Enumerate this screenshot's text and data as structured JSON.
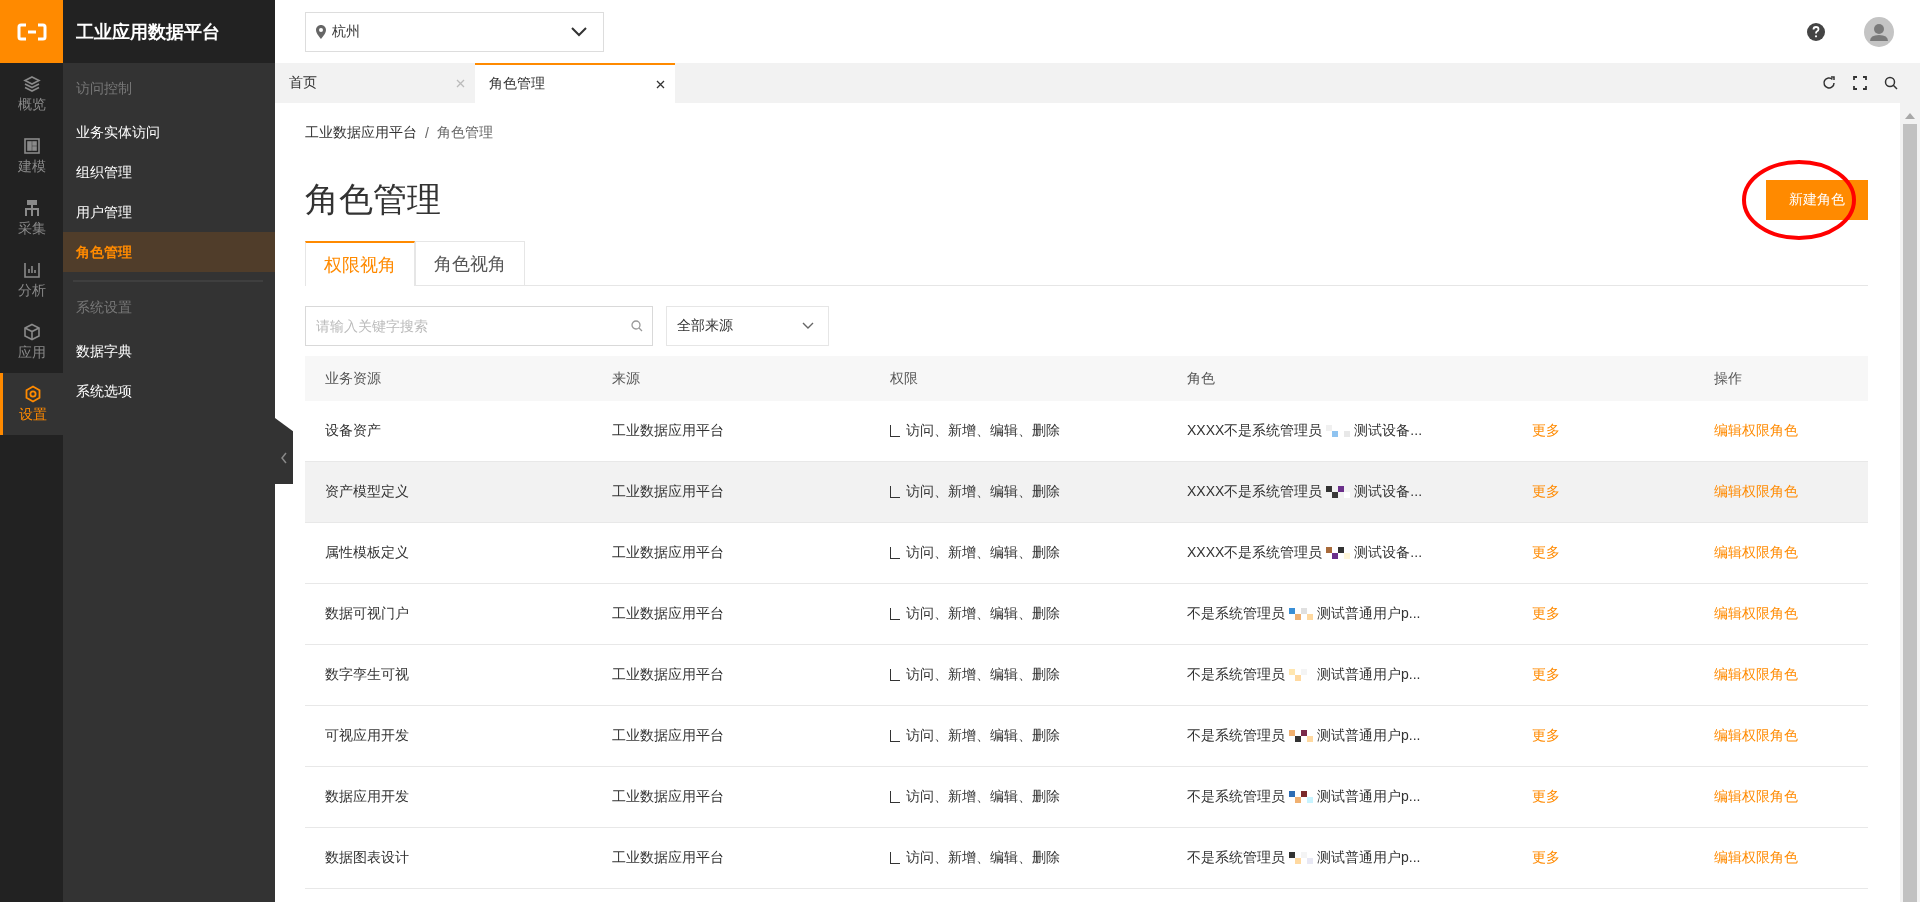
{
  "brand": {
    "title": "工业应用数据平台"
  },
  "rail": [
    {
      "label": "概览",
      "selected": false
    },
    {
      "label": "建模",
      "selected": false
    },
    {
      "label": "采集",
      "selected": false
    },
    {
      "label": "分析",
      "selected": false
    },
    {
      "label": "应用",
      "selected": false
    },
    {
      "label": "设置",
      "selected": true
    }
  ],
  "subnav_groups": [
    {
      "heading": "访问控制",
      "items": [
        {
          "label": "业务实体访问",
          "selected": false
        },
        {
          "label": "组织管理",
          "selected": false
        },
        {
          "label": "用户管理",
          "selected": false
        },
        {
          "label": "角色管理",
          "selected": true
        }
      ]
    },
    {
      "heading": "系统设置",
      "items": [
        {
          "label": "数据字典",
          "selected": false
        },
        {
          "label": "系统选项",
          "selected": false
        }
      ]
    }
  ],
  "topbar": {
    "city": "杭州"
  },
  "page_tabs": [
    {
      "label": "首页",
      "selected": false
    },
    {
      "label": "角色管理",
      "selected": true
    }
  ],
  "breadcrumb": {
    "items": [
      "工业数据应用平台",
      "角色管理"
    ],
    "separator": "/"
  },
  "title": "角色管理",
  "new_button": {
    "label": "新建角色",
    "highlighted": true
  },
  "view_tabs": [
    {
      "label": "权限视角",
      "selected": true
    },
    {
      "label": "角色视角",
      "selected": false
    }
  ],
  "search": {
    "placeholder": "请输入关键字搜索"
  },
  "source_filter": {
    "value": "全部来源"
  },
  "table": {
    "columns": [
      "业务资源",
      "来源",
      "权限",
      "角色",
      "操作"
    ],
    "rows": [
      {
        "resource": "设备资产",
        "source": "工业数据应用平台",
        "permission": "访问、新增、编辑、删除",
        "role_start": "XXXX不是系统管理员",
        "role_end": "测试设备...",
        "more": "更多",
        "action": "编辑权限角色",
        "selected": false
      },
      {
        "resource": "资产模型定义",
        "source": "工业数据应用平台",
        "permission": "访问、新增、编辑、删除",
        "role_start": "XXXX不是系统管理员",
        "role_end": "测试设备...",
        "more": "更多",
        "action": "编辑权限角色",
        "selected": true
      },
      {
        "resource": "属性模板定义",
        "source": "工业数据应用平台",
        "permission": "访问、新增、编辑、删除",
        "role_start": "XXXX不是系统管理员",
        "role_end": "测试设备...",
        "more": "更多",
        "action": "编辑权限角色",
        "selected": false
      },
      {
        "resource": "数据可视门户",
        "source": "工业数据应用平台",
        "permission": "访问、新增、编辑、删除",
        "role_start": "不是系统管理员",
        "role_end": "测试普通用户p...",
        "more": "更多",
        "action": "编辑权限角色",
        "selected": false
      },
      {
        "resource": "数字孪生可视",
        "source": "工业数据应用平台",
        "permission": "访问、新增、编辑、删除",
        "role_start": "不是系统管理员",
        "role_end": "测试普通用户p...",
        "more": "更多",
        "action": "编辑权限角色",
        "selected": false
      },
      {
        "resource": "可视应用开发",
        "source": "工业数据应用平台",
        "permission": "访问、新增、编辑、删除",
        "role_start": "不是系统管理员",
        "role_end": "测试普通用户p...",
        "more": "更多",
        "action": "编辑权限角色",
        "selected": false
      },
      {
        "resource": "数据应用开发",
        "source": "工业数据应用平台",
        "permission": "访问、新增、编辑、删除",
        "role_start": "不是系统管理员",
        "role_end": "测试普通用户p...",
        "more": "更多",
        "action": "编辑权限角色",
        "selected": false
      },
      {
        "resource": "数据图表设计",
        "source": "工业数据应用平台",
        "permission": "访问、新增、编辑、删除",
        "role_start": "不是系统管理员",
        "role_end": "测试普通用户p...",
        "more": "更多",
        "action": "编辑权限角色",
        "selected": false
      }
    ]
  }
}
